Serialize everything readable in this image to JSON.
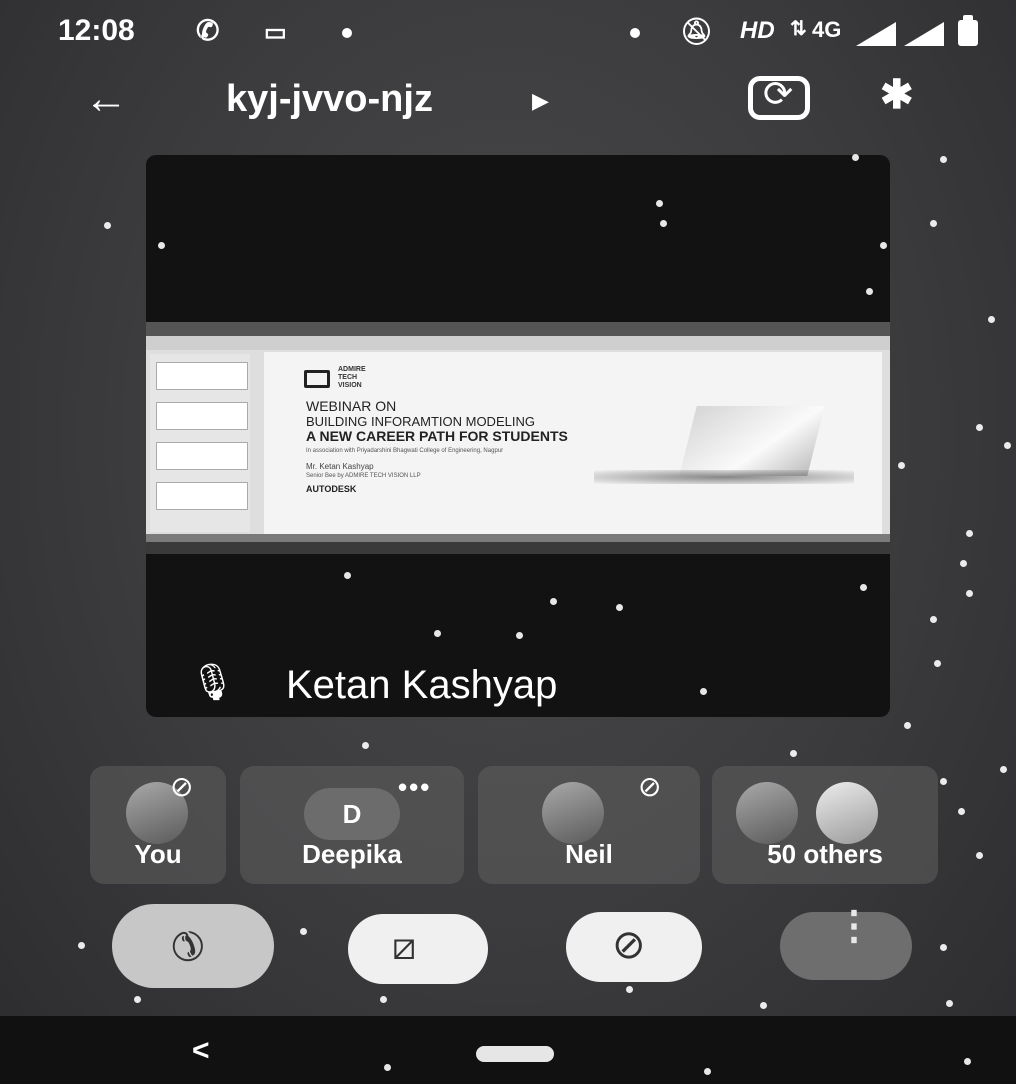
{
  "status_bar": {
    "time": "12:08",
    "hd": "HD",
    "network": "4G"
  },
  "meeting": {
    "code": "kyj-jvvo-njz"
  },
  "presentation": {
    "logo_text": "ADMIRE TECH VISION",
    "line1": "WEBINAR ON",
    "line2": "BUILDING INFORAMTION MODELING",
    "line3": "A NEW CAREER PATH FOR STUDENTS",
    "line4": "In association with Priyadarshini Bhagwati College of Engineering, Nagpur",
    "line5": "Mr. Ketan Kashyap",
    "line6": "Senior Bee by ADMIRE TECH VISION LLP",
    "line7": "AUTODESK"
  },
  "speaker": {
    "name": "Ketan Kashyap"
  },
  "participants": [
    {
      "name": "You"
    },
    {
      "name": "Deepika",
      "initial": "D"
    },
    {
      "name": "Neil"
    },
    {
      "name": "50 others"
    }
  ],
  "icons": {
    "back": "back-arrow-icon",
    "switch_camera": "switch-camera-icon",
    "bluetooth": "bluetooth-icon",
    "mic_off": "mic-off-icon",
    "cam_off": "camera-off-icon",
    "end_call": "end-call-icon",
    "more": "more-options-icon"
  },
  "colors": {
    "background": "#3b3b3d",
    "tile": "#5f5f5f",
    "end_call": "#c7c7c7",
    "control_light": "#f0f0f0",
    "more_control": "#6e6e6e"
  }
}
